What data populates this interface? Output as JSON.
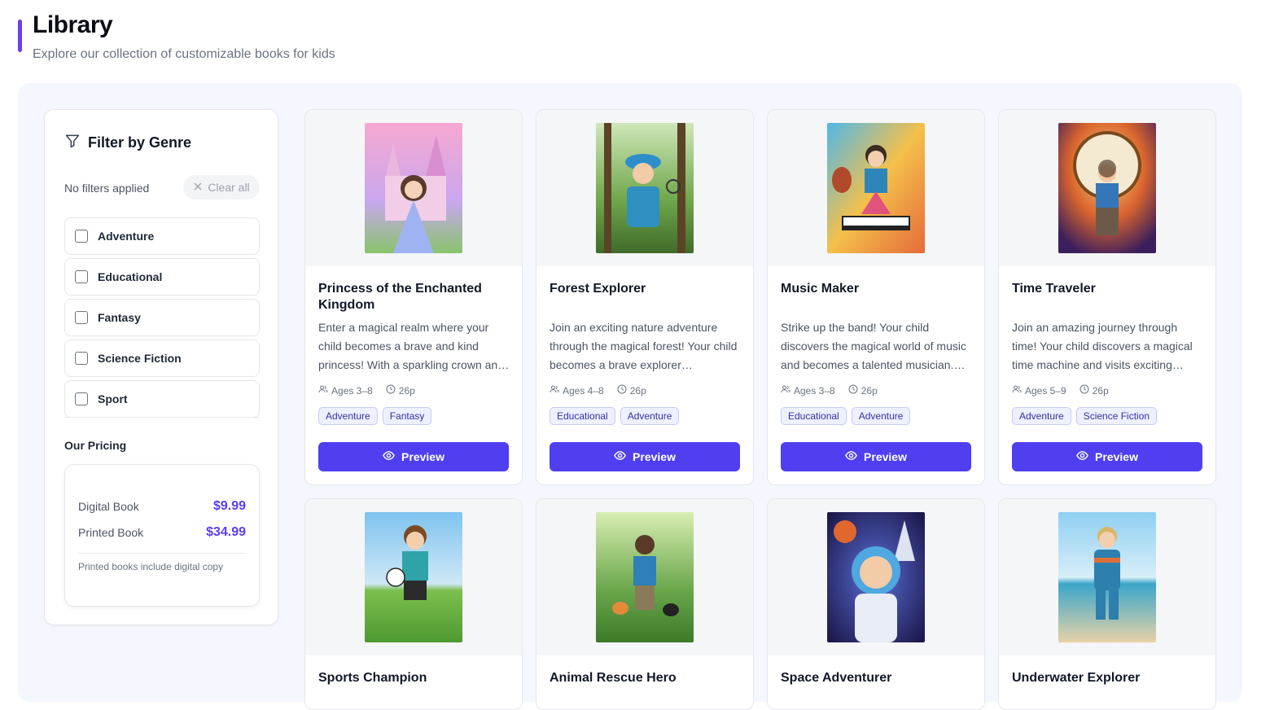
{
  "header": {
    "title": "Library",
    "subtitle": "Explore our collection of customizable books for kids"
  },
  "sidebar": {
    "filter_title": "Filter by Genre",
    "filter_icon": "funnel-icon",
    "no_filters": "No filters applied",
    "clear_all": "Clear all",
    "genres": [
      "Adventure",
      "Educational",
      "Fantasy",
      "Science Fiction",
      "Sport"
    ],
    "pricing_title": "Our Pricing",
    "pricing": {
      "digital_label": "Digital Book",
      "digital_price": "$9.99",
      "printed_label": "Printed Book",
      "printed_price": "$34.99",
      "note": "Printed books include digital copy"
    }
  },
  "books": [
    {
      "title": "Princess of the Enchanted Kingdom",
      "description": "Enter a magical realm where your child becomes a brave and kind princess! With a sparkling crown and a heart full of courage, she discovers the wonders of the kingdom.",
      "ages": "Ages 3–8",
      "pages": "26p",
      "tags": [
        "Adventure",
        "Fantasy"
      ],
      "preview": "Preview"
    },
    {
      "title": "Forest Explorer",
      "description": "Join an exciting nature adventure through the magical forest! Your child becomes a brave explorer discovering hidden wonders along the trail.",
      "ages": "Ages 4–8",
      "pages": "26p",
      "tags": [
        "Educational",
        "Adventure"
      ],
      "preview": "Preview"
    },
    {
      "title": "Music Maker",
      "description": "Strike up the band! Your child discovers the magical world of music and becomes a talented musician. Every instrument brings a new melody.",
      "ages": "Ages 3–8",
      "pages": "26p",
      "tags": [
        "Educational",
        "Adventure"
      ],
      "preview": "Preview"
    },
    {
      "title": "Time Traveler",
      "description": "Join an amazing journey through time! Your child discovers a magical time machine and visits exciting moments from the past and future.",
      "ages": "Ages 5–9",
      "pages": "26p",
      "tags": [
        "Adventure",
        "Science Fiction"
      ],
      "preview": "Preview"
    },
    {
      "title": "Sports Champion"
    },
    {
      "title": "Animal Rescue Hero"
    },
    {
      "title": "Space Adventurer"
    },
    {
      "title": "Underwater Explorer"
    }
  ],
  "colors": {
    "accent": "#6d3df0",
    "button": "#4f3ff0",
    "price": "#5a3df0",
    "panel_bg": "#f4f7fd"
  }
}
